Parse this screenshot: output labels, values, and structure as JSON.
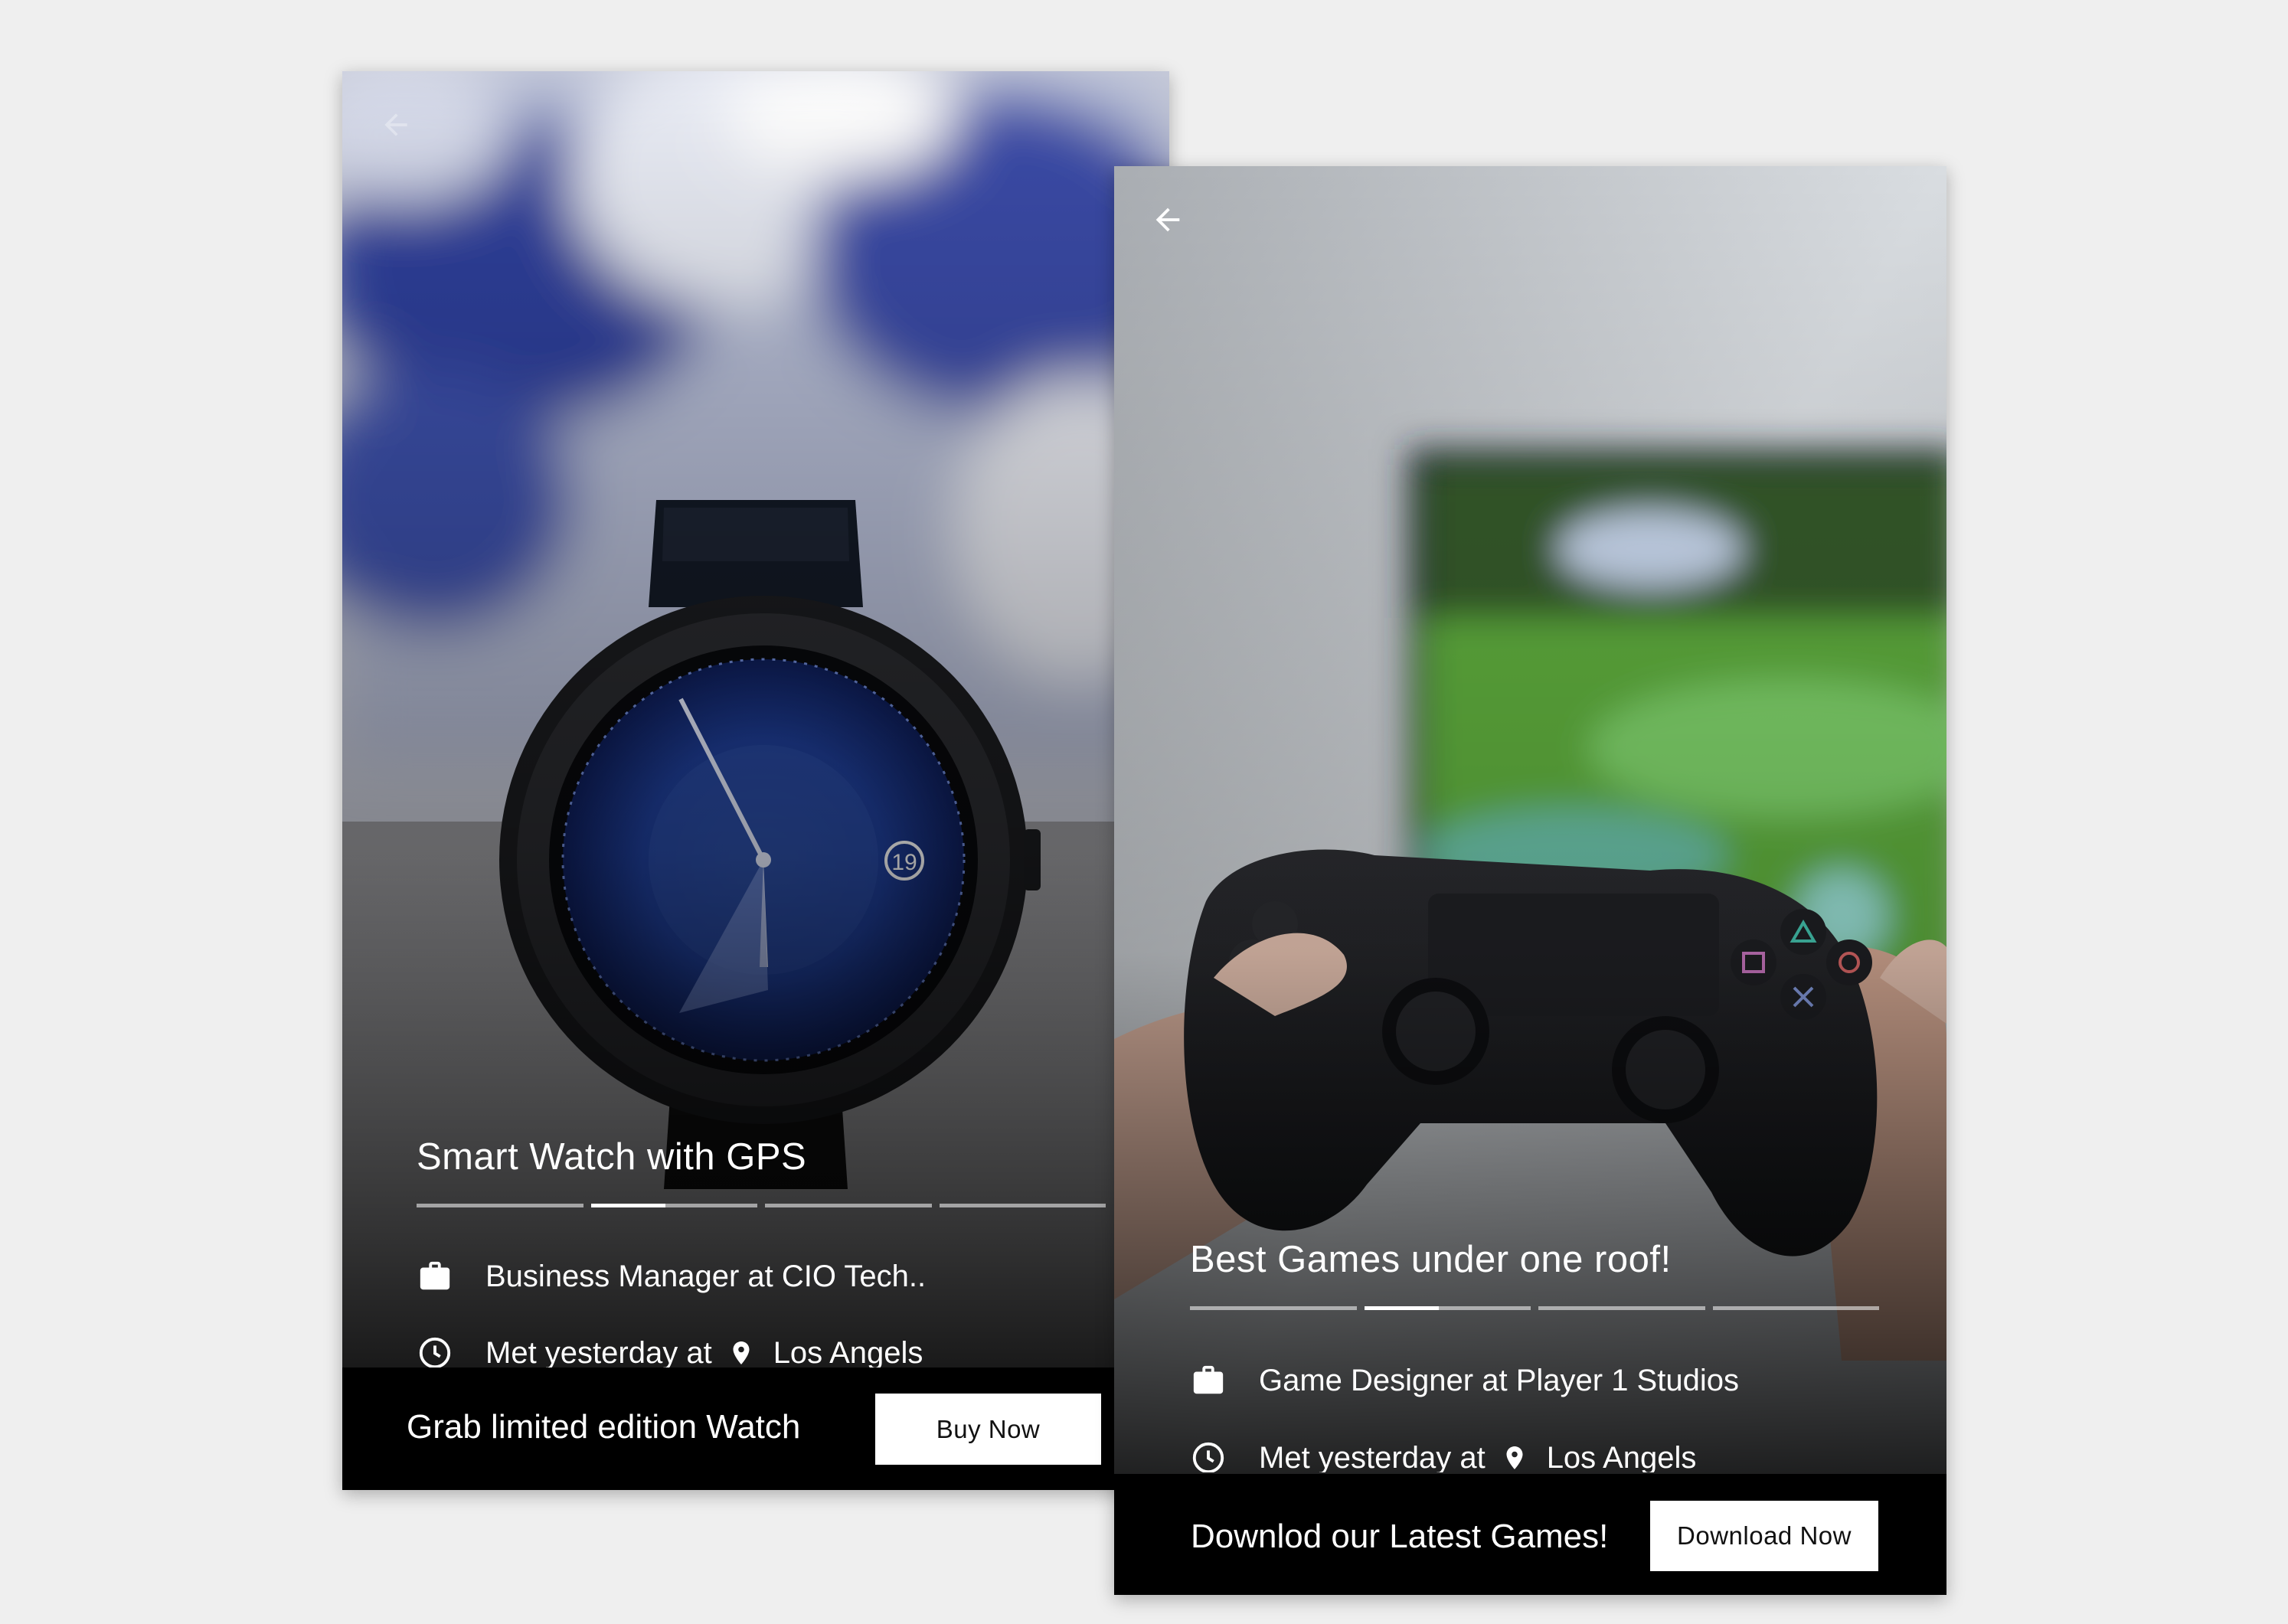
{
  "cards": [
    {
      "title": "Smart Watch with GPS",
      "progress_segments": 4,
      "active_segment": 1,
      "active_fraction": 0.45,
      "job": "Business Manager at CIO Tech..",
      "met_prefix": "Met yesterday at",
      "location": "Los Angels",
      "bar_text": "Grab limited edition Watch",
      "button_label": "Buy Now",
      "watch_date": "19"
    },
    {
      "title": "Best Games under one roof!",
      "progress_segments": 4,
      "active_segment": 1,
      "active_fraction": 0.45,
      "job": "Game Designer at Player 1 Studios",
      "met_prefix": "Met yesterday at",
      "location": "Los Angels",
      "bar_text": "Downlod our Latest Games!",
      "button_label": "Download Now"
    }
  ],
  "icons": {
    "back": "back-arrow-icon",
    "job": "briefcase-icon",
    "time": "clock-icon",
    "location": "location-pin-icon"
  },
  "colors": {
    "background": "#efefef",
    "bar": "#000000",
    "button_bg": "#ffffff",
    "text": "#ffffff"
  }
}
